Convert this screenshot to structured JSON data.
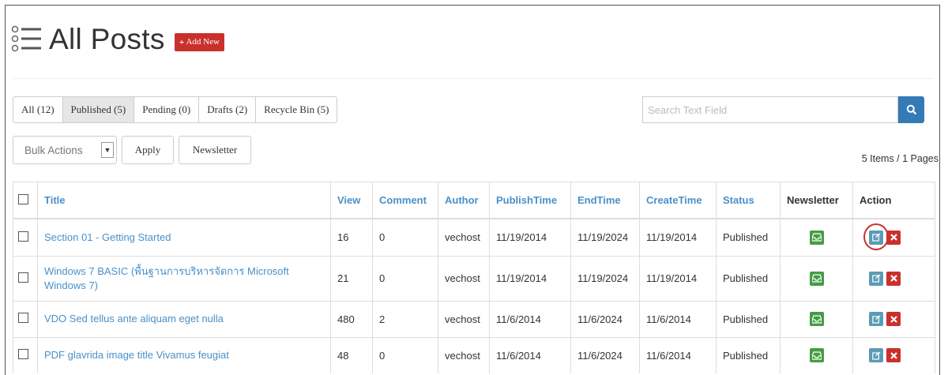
{
  "header": {
    "title": "All Posts",
    "add_new_label": "Add New"
  },
  "filters": [
    {
      "label": "All (12)",
      "active": false
    },
    {
      "label": "Published (5)",
      "active": true
    },
    {
      "label": "Pending (0)",
      "active": false
    },
    {
      "label": "Drafts (2)",
      "active": false
    },
    {
      "label": "Recycle Bin (5)",
      "active": false
    }
  ],
  "search": {
    "placeholder": "Search Text Field"
  },
  "toolbar": {
    "bulk_actions": "Bulk Actions",
    "apply_label": "Apply",
    "newsletter_label": "Newsletter",
    "items_count": "5 Items / 1 Pages"
  },
  "table": {
    "columns": [
      "Title",
      "View",
      "Comment",
      "Author",
      "PublishTime",
      "EndTime",
      "CreateTime",
      "Status",
      "Newsletter",
      "Action"
    ],
    "rows": [
      {
        "title": "Section 01 - Getting Started",
        "view": "16",
        "comment": "0",
        "author": "vechost",
        "publish": "11/19/2014",
        "end": "11/19/2024",
        "create": "11/19/2014",
        "status": "Published"
      },
      {
        "title": "Windows 7 BASIC (พื้นฐานการบริหารจัดการ Microsoft Windows 7)",
        "view": "21",
        "comment": "0",
        "author": "vechost",
        "publish": "11/19/2014",
        "end": "11/19/2024",
        "create": "11/19/2014",
        "status": "Published"
      },
      {
        "title": "VDO Sed tellus ante aliquam eget nulla",
        "view": "480",
        "comment": "2",
        "author": "vechost",
        "publish": "11/6/2014",
        "end": "11/6/2024",
        "create": "11/6/2014",
        "status": "Published"
      },
      {
        "title": "PDF glavrida image title Vivamus feugiat",
        "view": "48",
        "comment": "0",
        "author": "vechost",
        "publish": "11/6/2014",
        "end": "11/6/2024",
        "create": "11/6/2014",
        "status": "Published"
      }
    ]
  },
  "icons": {
    "list": "list-icon",
    "plus": "plus-icon",
    "search": "search-icon",
    "caret": "chevron-down-icon",
    "newsletter": "inbox-icon",
    "edit": "edit-icon",
    "delete": "close-icon"
  },
  "colors": {
    "link": "#4a90c9",
    "danger": "#c9302c",
    "success": "#449d44",
    "primary": "#337ab7",
    "info": "#5b9bb5"
  }
}
